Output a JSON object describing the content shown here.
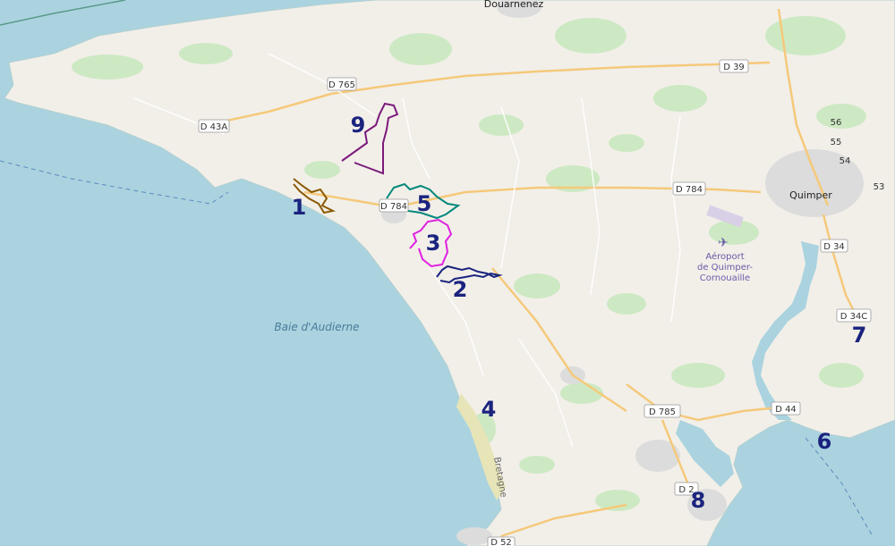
{
  "map": {
    "places": {
      "douarnenez": "Douarnenez",
      "quimper": "Quimper"
    },
    "roads": {
      "d765": "D 765",
      "d43a": "D 43A",
      "d784_west": "D 784",
      "d784_east": "D 784",
      "d39": "D 39",
      "d34": "D 34",
      "d34c": "D 34C",
      "d785": "D 785",
      "d44": "D 44",
      "d2": "D 2",
      "d52": "D 52",
      "r56": "56",
      "r55": "55",
      "r54": "54",
      "r53": "53"
    },
    "airport": {
      "line1": "Aéroport",
      "line2": "de Quimper-",
      "line3": "Cornouaille"
    },
    "water": {
      "bay": "Baie d'Audierne"
    },
    "region": "Bretagne",
    "routes": [
      {
        "number": "1",
        "color": "#8b5a00"
      },
      {
        "number": "2",
        "color": "#1a237e"
      },
      {
        "number": "3",
        "color": "#e020e0"
      },
      {
        "number": "4",
        "color": "#1a237e"
      },
      {
        "number": "5",
        "color": "#00897b"
      },
      {
        "number": "6",
        "color": "#1a237e"
      },
      {
        "number": "7",
        "color": "#1a237e"
      },
      {
        "number": "8",
        "color": "#1a237e"
      },
      {
        "number": "9",
        "color": "#7b1a7b"
      }
    ],
    "colors": {
      "sea": "#aad3df",
      "land": "#f2efe9",
      "forest": "#cde9c3",
      "urban": "#dcdcdc",
      "major_road": "#f5c97a",
      "label_numbers": "#1a237e"
    }
  }
}
